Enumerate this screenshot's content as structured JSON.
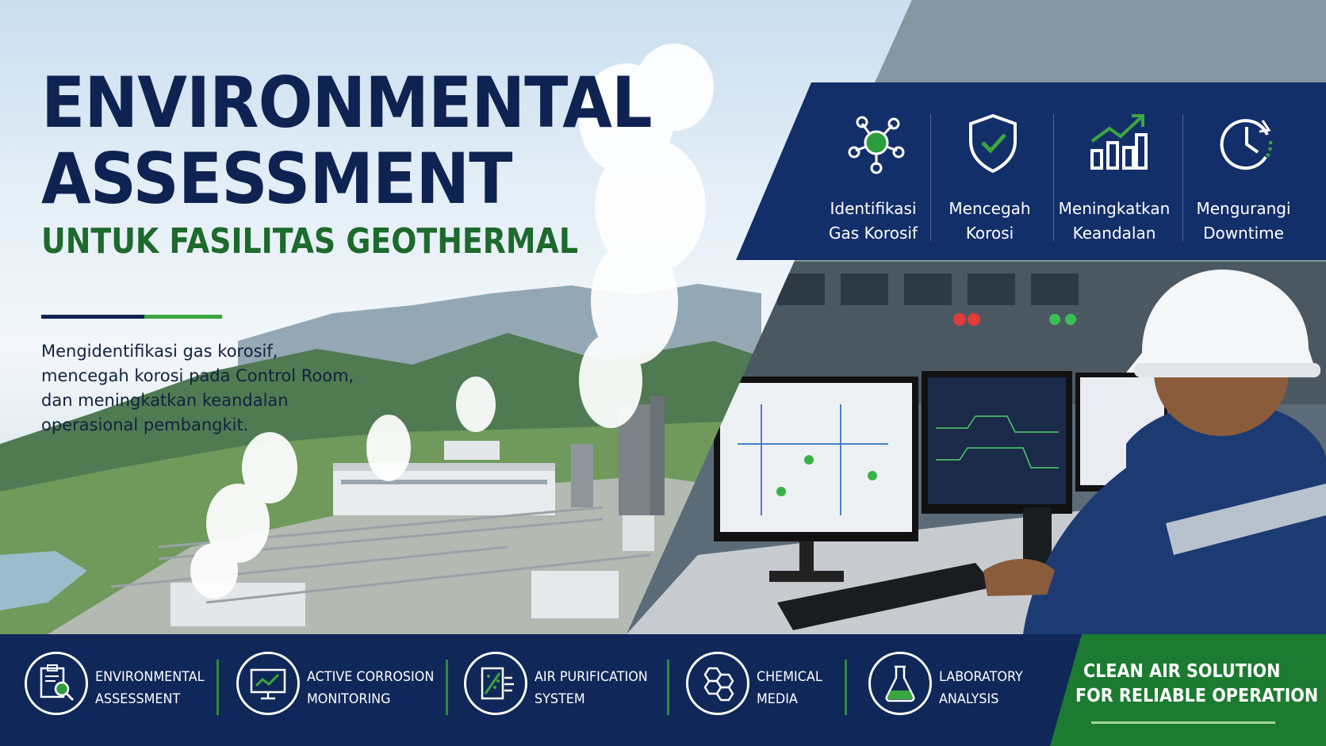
{
  "hero": {
    "title_line1": "ENVIRONMENTAL",
    "title_line2": "ASSESSMENT",
    "subtitle": "UNTUK FASILITAS GEOTHERMAL",
    "description_lines": [
      "Mengidentifikasi gas korosif,",
      "mencegah korosi pada Control Room,",
      "dan meningkatkan keandalan",
      "operasional pembangkit."
    ]
  },
  "benefits": [
    {
      "icon": "molecule-network-icon",
      "line1": "Identifikasi",
      "line2": "Gas Korosif"
    },
    {
      "icon": "shield-check-icon",
      "line1": "Mencegah",
      "line2": "Korosi"
    },
    {
      "icon": "bar-chart-up-icon",
      "line1": "Meningkatkan",
      "line2": "Keandalan"
    },
    {
      "icon": "clock-refresh-icon",
      "line1": "Mengurangi",
      "line2": "Downtime"
    }
  ],
  "services": [
    {
      "icon": "clipboard-search-icon",
      "line1": "ENVIRONMENTAL",
      "line2": "ASSESSMENT"
    },
    {
      "icon": "monitor-chart-icon",
      "line1": "ACTIVE CORROSION",
      "line2": "MONITORING"
    },
    {
      "icon": "air-filter-icon",
      "line1": "AIR PURIFICATION",
      "line2": "SYSTEM"
    },
    {
      "icon": "hexagon-media-icon",
      "line1": "CHEMICAL",
      "line2": "MEDIA"
    },
    {
      "icon": "flask-icon",
      "line1": "LABORATORY",
      "line2": "ANALYSIS"
    }
  ],
  "cta": {
    "line1": "CLEAN AIR SOLUTION",
    "line2": "FOR RELIABLE OPERATION"
  },
  "colors": {
    "navy": "#0f2352",
    "green": "#1d6a2d",
    "accent_green": "#3ba63f",
    "band": "#132f69"
  }
}
